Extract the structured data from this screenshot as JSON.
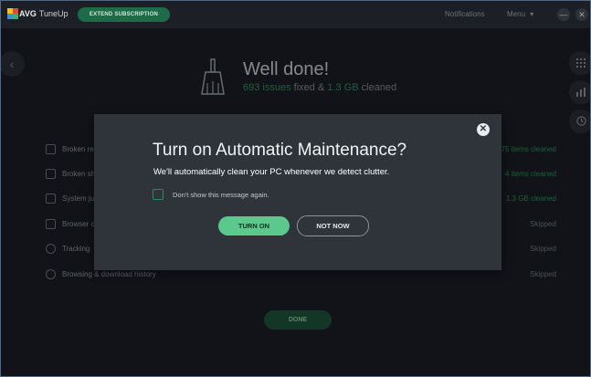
{
  "titlebar": {
    "brand": "AVG",
    "product": "TuneUp",
    "extend_label": "EXTEND SUBSCRIPTION",
    "notifications_label": "Notifications",
    "menu_label": "Menu",
    "menu_chevron": "▾",
    "minimize_glyph": "—",
    "close_glyph": "✕"
  },
  "summary": {
    "title": "Well done!",
    "issues_count": "693 issues",
    "fixed_text": "fixed &",
    "cleaned_size": "1.3 GB",
    "cleaned_text": "cleaned"
  },
  "rows": [
    {
      "label": "Broken re",
      "status": "75 items cleaned",
      "status_color": "green",
      "icon": "registry-icon"
    },
    {
      "label": "Broken sh",
      "status": "4 items cleaned",
      "status_color": "green",
      "icon": "shortcut-icon"
    },
    {
      "label": "System ju",
      "status": "1.3 GB cleaned",
      "status_color": "green",
      "icon": "trash-icon"
    },
    {
      "label": "Browser c",
      "status": "Skipped",
      "status_color": "gray",
      "icon": "browser-icon"
    },
    {
      "label": "Tracking",
      "status": "Skipped",
      "status_color": "gray",
      "icon": "tracking-icon"
    },
    {
      "label": "Browsing & download history",
      "status": "Skipped",
      "status_color": "gray",
      "icon": "history-icon"
    }
  ],
  "done_label": "DONE",
  "modal": {
    "title": "Turn on Automatic Maintenance?",
    "description": "We'll automatically clean your PC whenever we detect clutter.",
    "checkbox_label": "Don't show this message again.",
    "checkbox_checked": false,
    "turn_on_label": "TURN ON",
    "not_now_label": "NOT NOW",
    "close_glyph": "✕"
  },
  "side_icons": [
    "grid-icon",
    "bar-chart-icon",
    "history-clock-icon"
  ],
  "colors": {
    "accent_green": "#5cc88b",
    "dark_green": "#1d6b47",
    "background": "#161a1f",
    "modal_bg": "#2f343b"
  }
}
